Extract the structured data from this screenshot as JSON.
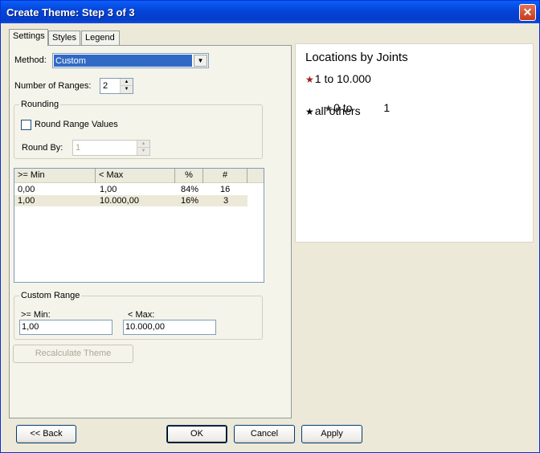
{
  "window": {
    "title": "Create Theme: Step 3 of 3",
    "close_glyph": "✕"
  },
  "tabs": [
    {
      "label": "Settings",
      "active": true
    },
    {
      "label": "Styles",
      "active": false
    },
    {
      "label": "Legend",
      "active": false
    }
  ],
  "settings": {
    "method_label": "Method:",
    "method_value": "Custom",
    "num_ranges_label": "Number of Ranges:",
    "num_ranges_value": "2",
    "rounding": {
      "title": "Rounding",
      "round_values_label": "Round Range Values",
      "round_values_checked": false,
      "round_by_label": "Round By:",
      "round_by_value": "1"
    },
    "table": {
      "columns": [
        ">= Min",
        "< Max",
        "%",
        "#"
      ],
      "rows": [
        [
          "0,00",
          "1,00",
          "84%",
          "16"
        ],
        [
          "1,00",
          "10.000,00",
          "16%",
          "3"
        ]
      ]
    },
    "custom_range": {
      "title": "Custom Range",
      "min_label": ">= Min:",
      "min_value": "1,00",
      "max_label": "< Max:",
      "max_value": "10.000,00"
    },
    "recalculate_label": "Recalculate Theme"
  },
  "preview": {
    "title": "Locations by Joints",
    "items": [
      {
        "label": "1 to 10.000",
        "color": "#a51c1c"
      },
      {
        "label": "0 to          1",
        "color": "#333333"
      },
      {
        "label": "all others",
        "color": "#000000"
      }
    ]
  },
  "footer": {
    "back_label": "<< Back",
    "ok_label": "OK",
    "cancel_label": "Cancel",
    "apply_label": "Apply"
  },
  "colors": {
    "titlebar": "#0543d8",
    "selection": "#316ac5",
    "dialog_bg": "#ece9d8"
  }
}
